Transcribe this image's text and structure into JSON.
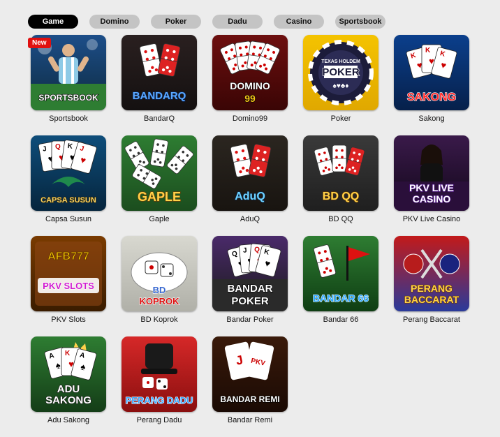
{
  "tabs": [
    {
      "label": "Game",
      "active": true
    },
    {
      "label": "Domino",
      "active": false
    },
    {
      "label": "Poker",
      "active": false
    },
    {
      "label": "Dadu",
      "active": false
    },
    {
      "label": "Casino",
      "active": false
    },
    {
      "label": "Sportsbook",
      "active": false
    }
  ],
  "badge": "New",
  "games": [
    {
      "name": "Sportsbook",
      "logo": "SPORTSBOOK",
      "icon": "football-player-icon"
    },
    {
      "name": "BandarQ",
      "logo": "BANDARQ",
      "icon": "domino-hand-icon"
    },
    {
      "name": "Domino99",
      "logo": "DOMINO 99",
      "icon": "domino-fan-icon"
    },
    {
      "name": "Poker",
      "logo": "POKER",
      "sublogo": "TEXAS HOLDEM",
      "icon": "poker-chip-icon"
    },
    {
      "name": "Sakong",
      "logo": "SAKONG",
      "icon": "king-cards-icon"
    },
    {
      "name": "Capsa Susun",
      "logo": "CAPSA SUSUN",
      "icon": "dragon-cards-icon"
    },
    {
      "name": "Gaple",
      "logo": "GAPLE",
      "icon": "domino-tiles-icon"
    },
    {
      "name": "AduQ",
      "logo": "ADUQ",
      "icon": "domino-hand-icon"
    },
    {
      "name": "BD QQ",
      "logo": "BD QQ",
      "icon": "domino-fan-icon"
    },
    {
      "name": "PKV Live Casino",
      "logo": "PKV LIVE CASINO",
      "icon": "live-dealer-icon"
    },
    {
      "name": "PKV Slots",
      "logo": "PKV SLOTS",
      "sublogo": "AFB777",
      "icon": "slots-icon"
    },
    {
      "name": "BD Koprok",
      "logo": "BD KOPROK",
      "icon": "dice-icon"
    },
    {
      "name": "Bandar Poker",
      "logo": "BANDAR POKER",
      "icon": "poker-cards-icon"
    },
    {
      "name": "Bandar 66",
      "logo": "BANDAR 66",
      "icon": "domino-flag-icon"
    },
    {
      "name": "Perang Baccarat",
      "logo": "PERANG BACCARAT",
      "icon": "crossed-swords-icon"
    },
    {
      "name": "Adu Sakong",
      "logo": "ADU SAKONG",
      "icon": "crown-cards-icon"
    },
    {
      "name": "Perang Dadu",
      "logo": "PERANG DADU",
      "icon": "dice-cup-icon"
    },
    {
      "name": "Bandar Remi",
      "logo": "BANDAR REMI",
      "sublogo": "PKV",
      "icon": "joker-card-icon"
    }
  ]
}
